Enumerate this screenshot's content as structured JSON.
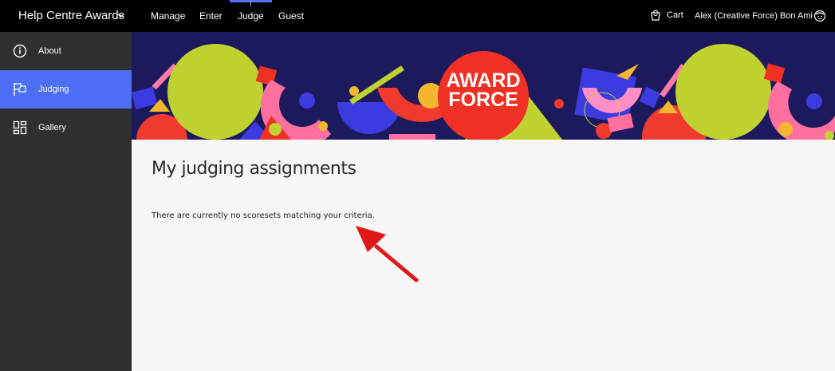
{
  "topbar": {
    "brand": "Help Centre Awards",
    "nav": [
      "Manage",
      "Enter",
      "Judge",
      "Guest"
    ],
    "active_nav": "Judge",
    "cart_label": "Cart",
    "user_name": "Alex (Creative Force) Bon Ami"
  },
  "sidebar": {
    "items": [
      {
        "label": "About",
        "icon": "info-icon"
      },
      {
        "label": "Judging",
        "icon": "flag-icon",
        "active": true
      },
      {
        "label": "Gallery",
        "icon": "gallery-grid-icon"
      }
    ]
  },
  "banner": {
    "logo_line1": "AWARD",
    "logo_line2": "FORCE"
  },
  "main": {
    "title": "My judging assignments",
    "empty_message": "There are currently no scoresets matching your criteria."
  },
  "colors": {
    "topbar_bg": "#000000",
    "sidebar_bg": "#2f2f2f",
    "active_item": "#4c6ef5",
    "banner_bg": "#1c1a5c",
    "logo_red": "#ee3124",
    "arrow_red": "#e01818"
  }
}
